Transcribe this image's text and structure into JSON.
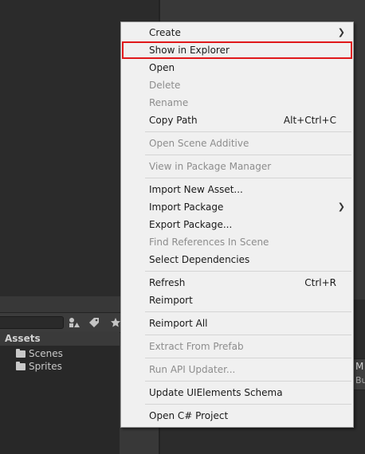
{
  "project_panel": {
    "header": "Assets",
    "folders": [
      "Scenes",
      "Sprites"
    ],
    "side_panel_text_1": "M",
    "side_panel_text_2": "Bui"
  },
  "context_menu": {
    "items": [
      {
        "label": "Create",
        "shortcut": "",
        "submenu": true,
        "disabled": false
      },
      {
        "label": "Show in Explorer",
        "shortcut": "",
        "submenu": false,
        "disabled": false,
        "highlighted": true
      },
      {
        "label": "Open",
        "shortcut": "",
        "submenu": false,
        "disabled": false
      },
      {
        "label": "Delete",
        "shortcut": "",
        "submenu": false,
        "disabled": true
      },
      {
        "label": "Rename",
        "shortcut": "",
        "submenu": false,
        "disabled": true
      },
      {
        "label": "Copy Path",
        "shortcut": "Alt+Ctrl+C",
        "submenu": false,
        "disabled": false
      },
      {
        "label": "Open Scene Additive",
        "shortcut": "",
        "submenu": false,
        "disabled": true
      },
      {
        "label": "View in Package Manager",
        "shortcut": "",
        "submenu": false,
        "disabled": true
      },
      {
        "label": "Import New Asset...",
        "shortcut": "",
        "submenu": false,
        "disabled": false
      },
      {
        "label": "Import Package",
        "shortcut": "",
        "submenu": true,
        "disabled": false
      },
      {
        "label": "Export Package...",
        "shortcut": "",
        "submenu": false,
        "disabled": false
      },
      {
        "label": "Find References In Scene",
        "shortcut": "",
        "submenu": false,
        "disabled": true
      },
      {
        "label": "Select Dependencies",
        "shortcut": "",
        "submenu": false,
        "disabled": false
      },
      {
        "label": "Refresh",
        "shortcut": "Ctrl+R",
        "submenu": false,
        "disabled": false
      },
      {
        "label": "Reimport",
        "shortcut": "",
        "submenu": false,
        "disabled": false
      },
      {
        "label": "Reimport All",
        "shortcut": "",
        "submenu": false,
        "disabled": false
      },
      {
        "label": "Extract From Prefab",
        "shortcut": "",
        "submenu": false,
        "disabled": true
      },
      {
        "label": "Run API Updater...",
        "shortcut": "",
        "submenu": false,
        "disabled": true
      },
      {
        "label": "Update UIElements Schema",
        "shortcut": "",
        "submenu": false,
        "disabled": false
      },
      {
        "label": "Open C# Project",
        "shortcut": "",
        "submenu": false,
        "disabled": false
      }
    ]
  },
  "colors": {
    "highlight_border": "#e0181a",
    "menu_background": "#f0f0f0",
    "disabled_text": "#8d8d8d"
  }
}
